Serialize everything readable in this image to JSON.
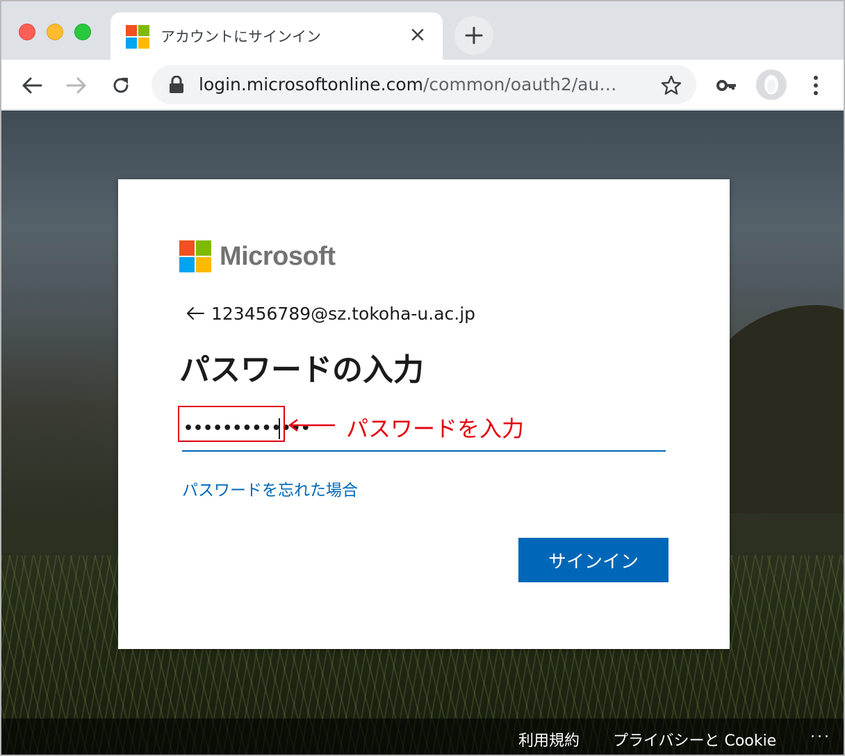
{
  "browser": {
    "tab_title": "アカウントにサインイン",
    "url_host": "login.microsoftonline.com",
    "url_path": "/common/oauth2/au…",
    "icons": [
      "close-icon",
      "plus-icon",
      "back-icon",
      "forward-icon",
      "reload-icon",
      "lock-icon",
      "star-icon",
      "key-icon",
      "avatar-icon",
      "kebab-menu-icon"
    ]
  },
  "card": {
    "brand": "Microsoft",
    "identity": "123456789@sz.tokoha-u.ac.jp",
    "heading": "パスワードの入力",
    "password_masked": "•••••••••••••",
    "annotation": "パスワードを入力",
    "forgot_link": "パスワードを忘れた場合",
    "signin_label": "サインイン"
  },
  "footer": {
    "terms": "利用規約",
    "privacy": "プライバシーと Cookie",
    "more": "..."
  },
  "colors": {
    "accent": "#0067b8",
    "annotation": "#e3000f",
    "ms_red": "#f25022",
    "ms_green": "#7fba00",
    "ms_blue": "#00a4ef",
    "ms_yellow": "#ffb900"
  }
}
